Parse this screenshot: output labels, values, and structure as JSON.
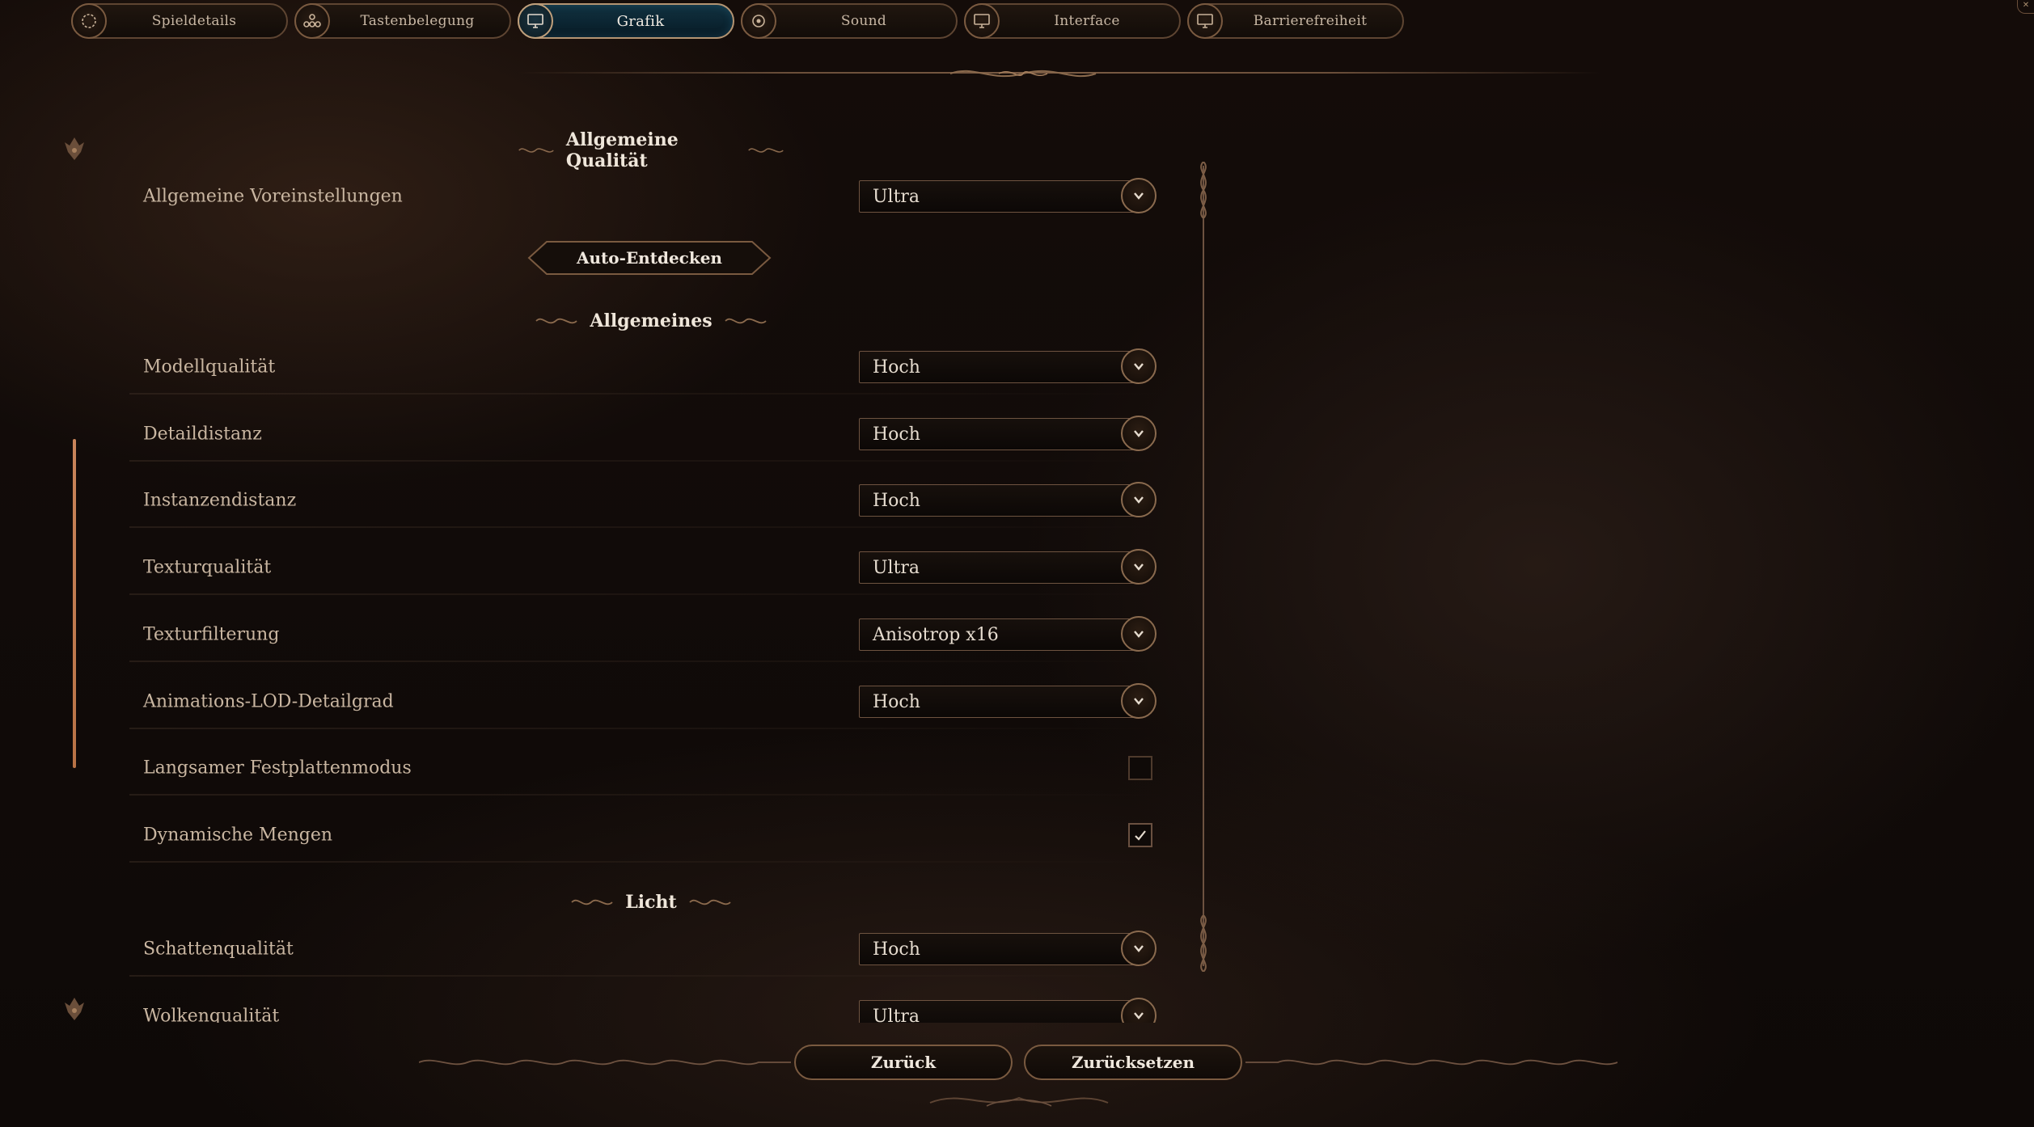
{
  "tabs": [
    {
      "label": "Spieldetails",
      "icon": "spinner-icon",
      "active": false
    },
    {
      "label": "Tastenbelegung",
      "icon": "controller-icon",
      "active": false
    },
    {
      "label": "Grafik",
      "icon": "monitor-icon",
      "active": true
    },
    {
      "label": "Sound",
      "icon": "speaker-icon",
      "active": false
    },
    {
      "label": "Interface",
      "icon": "monitor-icon",
      "active": false
    },
    {
      "label": "Barrierefreiheit",
      "icon": "monitor-icon",
      "active": false
    }
  ],
  "sections": {
    "quality": "Allgemeine Qualität",
    "general": "Allgemeines",
    "light": "Licht"
  },
  "settings": {
    "preset": {
      "label": "Allgemeine Voreinstellungen",
      "value": "Ultra"
    },
    "auto_detect": "Auto-Entdecken",
    "model_quality": {
      "label": "Modellqualität",
      "value": "Hoch"
    },
    "detail_dist": {
      "label": "Detaildistanz",
      "value": "Hoch"
    },
    "instance_dist": {
      "label": "Instanzendistanz",
      "value": "Hoch"
    },
    "texture_quality": {
      "label": "Texturqualität",
      "value": "Ultra"
    },
    "texture_filter": {
      "label": "Texturfilterung",
      "value": "Anisotrop x16"
    },
    "anim_lod": {
      "label": "Animations-LOD-Detailgrad",
      "value": "Hoch"
    },
    "slow_hdd": {
      "label": "Langsamer Festplattenmodus",
      "checked": false
    },
    "dynamic_crowds": {
      "label": "Dynamische Mengen",
      "checked": true
    },
    "shadow_quality": {
      "label": "Schattenqualität",
      "value": "Hoch"
    },
    "cloud_quality": {
      "label": "Wolkenqualität",
      "value": "Ultra"
    }
  },
  "footer": {
    "back": "Zurück",
    "reset": "Zurücksetzen"
  },
  "colors": {
    "accent_gold": "#b49472",
    "active_tab": "#0b2532",
    "scroll_thumb": "#c9845a"
  }
}
